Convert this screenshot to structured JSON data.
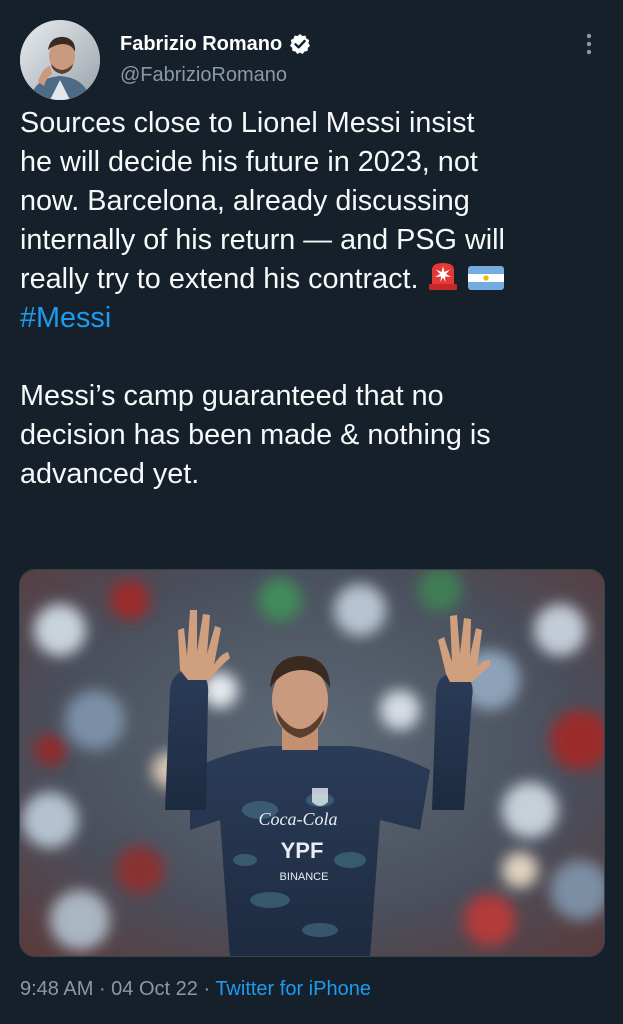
{
  "author": {
    "display_name": "Fabrizio Romano",
    "handle": "@FabrizioRomano",
    "verified": true
  },
  "tweet": {
    "lines_para1": [
      "Sources close to Lionel Messi insist",
      "he will decide his future in 2023, not",
      "now. Barcelona, already discussing",
      "internally of his return — and PSG will",
      "really try to extend his contract."
    ],
    "emojis": [
      "siren-emoji",
      "argentina-flag-emoji"
    ],
    "hashtag": "#Messi",
    "lines_para2": [
      "Messi’s camp guaranteed that no",
      "decision has been made & nothing is",
      "advanced yet."
    ]
  },
  "media": {
    "jersey_sponsor_1": "Coca-Cola",
    "jersey_sponsor_2": "YPF",
    "jersey_sponsor_3": "BINANCE"
  },
  "meta": {
    "time": "9:48 AM",
    "separator": " · ",
    "date": "04 Oct 22",
    "source": "Twitter for iPhone"
  },
  "colors": {
    "background": "#15202b",
    "text": "#f7f9f9",
    "muted": "#8b98a5",
    "link": "#1d9bf0"
  }
}
